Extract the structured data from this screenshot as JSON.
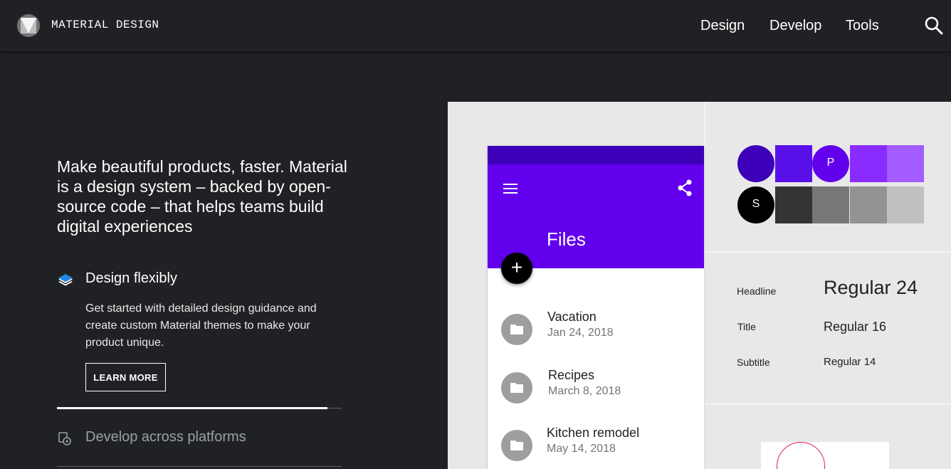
{
  "header": {
    "brand": "MATERIAL DESIGN",
    "nav": [
      "Design",
      "Develop",
      "Tools"
    ],
    "icons": {
      "logo": "material-logo-icon",
      "search": "search-icon"
    }
  },
  "hero": {
    "text": "Make beautiful products, faster. Material is a design system – backed by open-source code – that helps teams build digital experiences"
  },
  "features": [
    {
      "icon": "layers-icon",
      "title": "Design flexibly",
      "description": "Get started with detailed design guidance and create custom Material themes to make your product unique.",
      "button": "LEARN MORE",
      "progress": 0.95
    },
    {
      "icon": "devices-icon",
      "title": "Develop across platforms"
    }
  ],
  "illustration": {
    "app": {
      "title": "Files",
      "fab": "+",
      "files": [
        {
          "name": "Vacation",
          "date": "Jan 24, 2018"
        },
        {
          "name": "Recipes",
          "date": "March 8, 2018"
        },
        {
          "name": "Kitchen remodel",
          "date": "May 14, 2018"
        }
      ]
    },
    "swatch_labels": {
      "primary": "P",
      "secondary": "S"
    },
    "colors": {
      "primary_dark": "#3d00b8",
      "primary": "#6200ee",
      "accent1": "#5a10e8",
      "accent2": "#8a2cff",
      "accent3": "#a25cff",
      "black": "#000000",
      "grey1": "#343434",
      "grey2": "#777777",
      "grey3": "#939393",
      "grey4": "#c0bfc1"
    },
    "type_scale": [
      {
        "label": "Headline",
        "sample": "Regular 24"
      },
      {
        "label": "Title",
        "sample": "Regular 16"
      },
      {
        "label": "Subtitle",
        "sample": "Regular 14"
      }
    ]
  }
}
